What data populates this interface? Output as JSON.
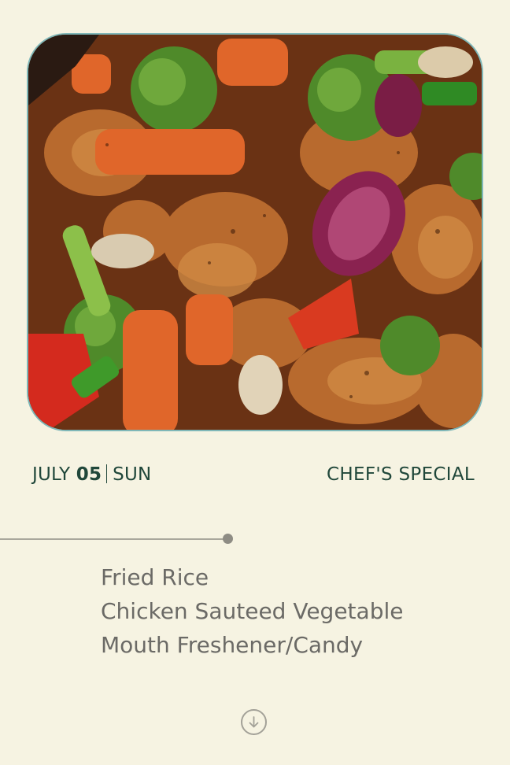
{
  "hero": {
    "image": "chicken-stir-fry-with-broccoli-carrots-peppers-onion"
  },
  "header": {
    "month": "JULY",
    "day": "05",
    "weekday": "SUN",
    "category": "CHEF'S SPECIAL"
  },
  "menu": {
    "items": [
      "Fried Rice",
      "Chicken Sauteed Vegetable",
      "Mouth Freshener/Candy"
    ]
  },
  "scroll": {
    "icon": "arrow-down-circle-icon"
  },
  "colors": {
    "background": "#f6f3e2",
    "accent_text": "#20473a",
    "menu_text": "#6b6a66",
    "timeline": "#a9a79c"
  }
}
